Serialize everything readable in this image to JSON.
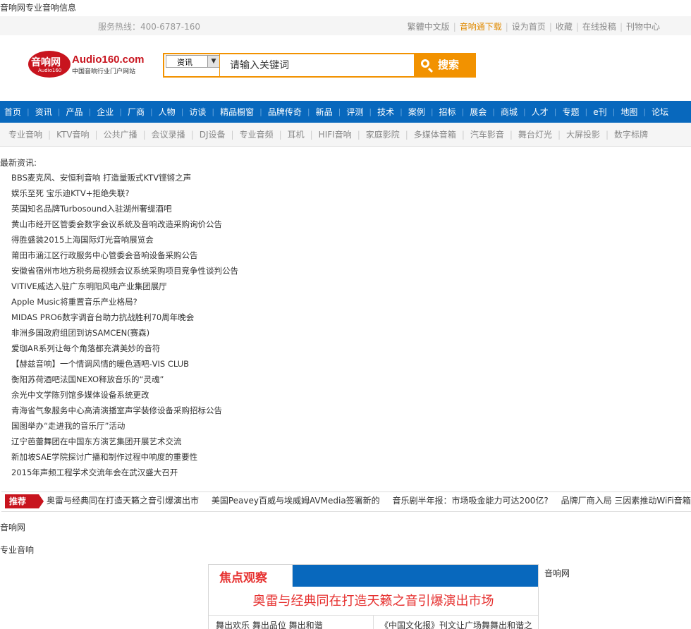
{
  "page": {
    "top_title": "音响网专业音响信息"
  },
  "topbar": {
    "hotline": "服务热线：400-6787-160",
    "links": [
      "繁體中文版",
      "音响通下载",
      "设为首页",
      "收藏",
      "在线投稿",
      "刊物中心"
    ]
  },
  "logo": {
    "mark": "音响网",
    "mark_sub": "Audio160",
    "site": "Audio160.com",
    "slogan": "中国音响行业门户网站"
  },
  "search": {
    "category": "资讯",
    "placeholder": "请输入关键词",
    "button_label": "搜索"
  },
  "main_nav": [
    "首页",
    "资讯",
    "产品",
    "企业",
    "厂商",
    "人物",
    "访谈",
    "精品橱窗",
    "品牌传奇",
    "新品",
    "评测",
    "技术",
    "案例",
    "招标",
    "展会",
    "商城",
    "人才",
    "专题",
    "e刊",
    "地图",
    "论坛"
  ],
  "sub_nav": [
    "专业音响",
    "KTV音响",
    "公共广播",
    "会议录播",
    "DJ设备",
    "专业音频",
    "耳机",
    "HIFI音响",
    "家庭影院",
    "多媒体音箱",
    "汽车影音",
    "舞台灯光",
    "大屏投影",
    "数字标牌"
  ],
  "latest": {
    "title": "最新资讯:",
    "items": [
      "BBS麦克风、安恒利音响 打造量贩式KTV铿锵之声",
      "娱乐至死 宝乐迪KTV+拒绝失联?",
      "英国知名品牌Turbosound入驻湖州奢缇酒吧",
      "黄山市经开区管委会数字会议系统及音响改造采购询价公告",
      "得胜盛装2015上海国际灯光音响展览会",
      "莆田市涵江区行政服务中心管委会音响设备采购公告",
      "安徽省宿州市地方税务局视频会议系统采购项目竞争性谈判公告",
      "VITIVE威达入驻广东明阳风电产业集团展厅",
      "Apple Music将重置音乐产业格局?",
      "MIDAS PRO6数字调音台助力抗战胜利70周年晚会",
      "非洲多国政府组团到访SAMCEN(赛森)",
      "爱珈AR系列让每个角落都充满美妙的音符",
      "【赫兹音响】一个情调风情的暖色酒吧-VIS CLUB",
      "衡阳苏荷酒吧法国NEXO释放音乐的“灵魂”",
      "余光中文学陈列馆多媒体设备系统更改",
      "青海省气象服务中心高清演播室声学装修设备采购招标公告",
      "国图举办“走进我的音乐厅”活动",
      "辽宁芭蕾舞团在中国东方演艺集团开展艺术交流",
      "新加坡SAE学院探讨广播和制作过程中响度的重要性",
      "2015年声频工程学术交流年会在武汉盛大召开"
    ]
  },
  "recommend": {
    "badge": "推荐",
    "items": [
      "奥雷与经典同在打造天籁之音引爆演出市",
      "美国Peavey百威与埃威姆AVMedia签署新的",
      "音乐剧半年报：市场吸金能力可达200亿?",
      "品牌厂商入局 三因素推动WiFi音箱成主流"
    ]
  },
  "footer_links": {
    "first": "音响网",
    "second": "专业音响"
  },
  "focus": {
    "tab_label": "焦点观察",
    "headline": "奥雷与经典同在打造天籁之音引爆演出市场",
    "left_item": "舞出欢乐 舞出品位 舞出和谐",
    "right_item": "《中国文化报》刊文让广场舞舞出和谐之"
  },
  "side": {
    "label": "音响网"
  },
  "colors": {
    "brand_blue": "#0868bd",
    "search_orange": "#f29200",
    "logo_red": "#c8141e",
    "focus_red": "#e6302f",
    "download_highlight": "#e08a00"
  }
}
